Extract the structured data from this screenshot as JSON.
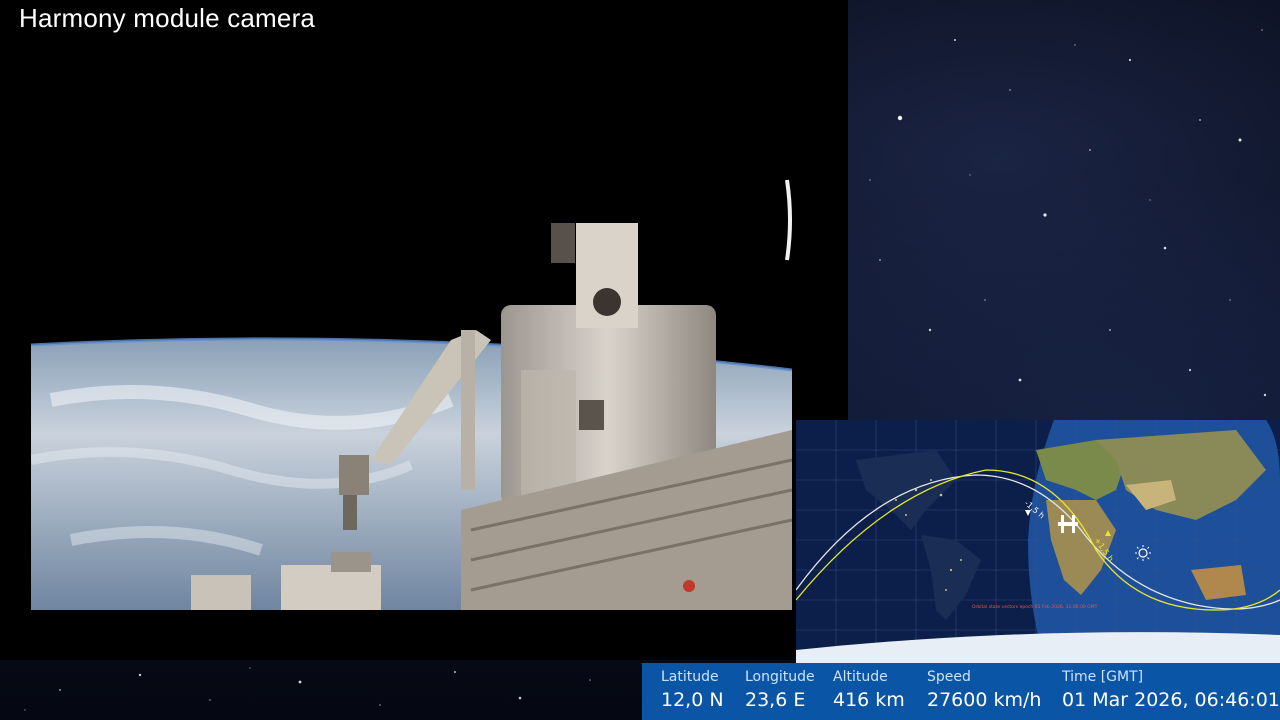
{
  "title": "Harmony module camera",
  "telemetry": {
    "latitude_label": "Latitude",
    "latitude_value": "12,0 N",
    "longitude_label": "Longitude",
    "longitude_value": "23,6 E",
    "altitude_label": "Altitude",
    "altitude_value": "416 km",
    "speed_label": "Speed",
    "speed_value": "27600 km/h",
    "time_label": "Time [GMT]",
    "time_value": "01 Mar 2026, 06:46:01"
  },
  "map": {
    "orbit_minus_label": "-1,5 h",
    "orbit_plus_label": "+1,5 h",
    "note_text": "Orbital state vectors epoch 01 Feb 2026, 11:00:00 GMT"
  },
  "colors": {
    "telemetry_bar": "#0b55a6",
    "orbit_past": "#e6e6e6",
    "orbit_future": "#e8e62a",
    "ocean": "#1d4f9a"
  },
  "icons": {
    "station": "iss-icon",
    "sun": "sun-icon"
  }
}
